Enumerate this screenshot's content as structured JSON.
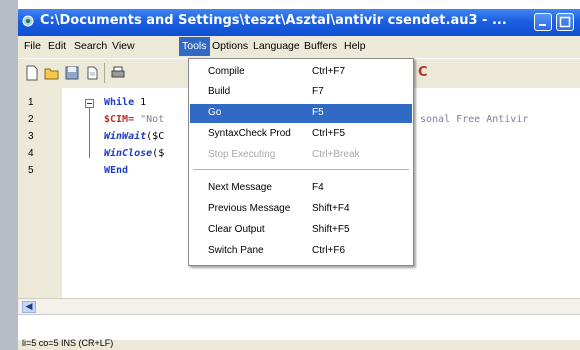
{
  "window": {
    "title": "C:\\Documents and Settings\\teszt\\Asztal\\antivir csendet.au3 - ..."
  },
  "menubar": {
    "items": [
      "File",
      "Edit",
      "Search",
      "View",
      "Tools",
      "Options",
      "Language",
      "Buffers",
      "Help"
    ],
    "active": "Tools"
  },
  "toolbar": {
    "trailing_char": "C"
  },
  "editor": {
    "line_numbers": [
      "1",
      "2",
      "3",
      "4",
      "5"
    ],
    "lines": [
      {
        "kw": "While",
        "rest": " 1"
      },
      {
        "kw": "$CIM=",
        "str": " \"Not"
      },
      {
        "kw": "WinWait",
        "rest": "($C"
      },
      {
        "kw": "WinClose",
        "rest": "($"
      },
      {
        "kw": "WEnd",
        "rest": ""
      }
    ],
    "right_fragment": "sonal  Free Antivir"
  },
  "tools_menu": {
    "items": [
      {
        "label": "Compile",
        "shortcut": "Ctrl+F7",
        "state": "normal"
      },
      {
        "label": "Build",
        "shortcut": "F7",
        "state": "normal"
      },
      {
        "label": "Go",
        "shortcut": "F5",
        "state": "highlighted"
      },
      {
        "label": "SyntaxCheck Prod",
        "shortcut": "Ctrl+F5",
        "state": "normal"
      },
      {
        "label": "Stop Executing",
        "shortcut": "Ctrl+Break",
        "state": "disabled"
      },
      {
        "label": "Next Message",
        "shortcut": "F4",
        "state": "normal"
      },
      {
        "label": "Previous Message",
        "shortcut": "Shift+F4",
        "state": "normal"
      },
      {
        "label": "Clear Output",
        "shortcut": "Shift+F5",
        "state": "normal"
      },
      {
        "label": "Switch Pane",
        "shortcut": "Ctrl+F6",
        "state": "normal"
      }
    ]
  },
  "statusbar": {
    "text": "li=5 co=5 INS (CR+LF)"
  },
  "colors": {
    "titlebar": "#1c5fe0",
    "highlight": "#316ac5",
    "keyword": "#1f3cc2"
  }
}
